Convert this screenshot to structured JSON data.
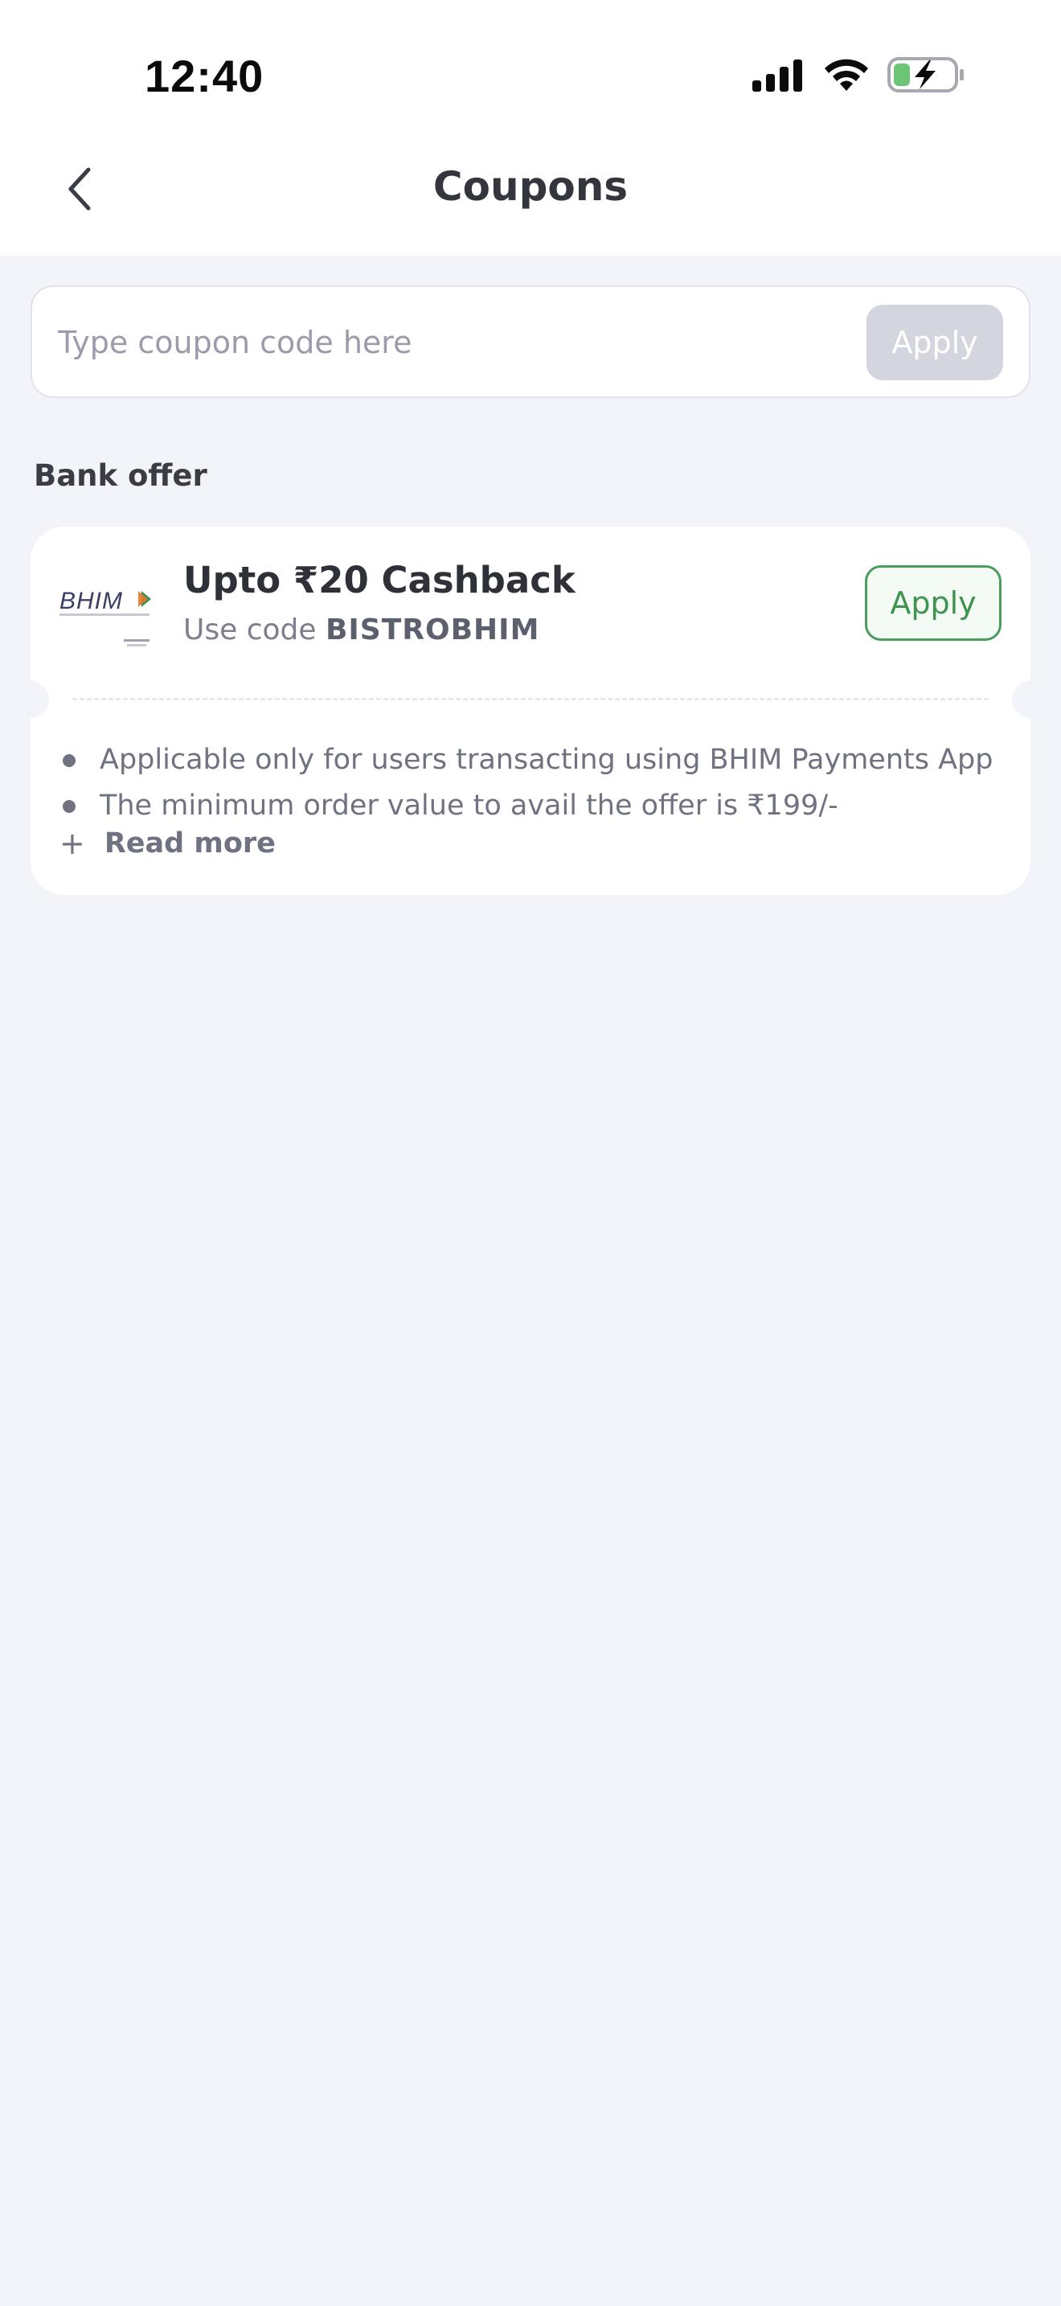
{
  "status_bar": {
    "time": "12:40"
  },
  "header": {
    "title": "Coupons"
  },
  "coupon_input": {
    "placeholder": "Type coupon code here",
    "value": "",
    "apply_label": "Apply"
  },
  "section": {
    "heading": "Bank offer"
  },
  "offer": {
    "bank_logo_text": "BHIM",
    "title": "Upto ₹20 Cashback",
    "code_prefix": "Use code ",
    "code": "BISTROBHIM",
    "apply_label": "Apply",
    "terms": [
      "Applicable only for users transacting using BHIM Payments App",
      "The minimum order value to avail the offer is ₹199/-"
    ],
    "read_more_label": "Read more"
  },
  "colors": {
    "background": "#f3f4f9",
    "accent_green": "#3e944f",
    "battery_green": "#6cc477",
    "disabled_button": "#d3d6de"
  }
}
